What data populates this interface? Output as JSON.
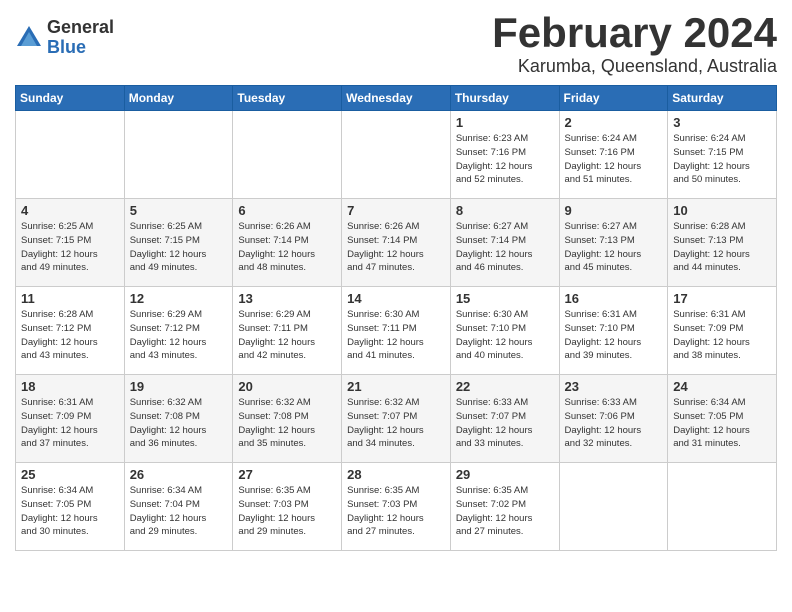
{
  "logo": {
    "general": "General",
    "blue": "Blue"
  },
  "title": "February 2024",
  "location": "Karumba, Queensland, Australia",
  "headers": [
    "Sunday",
    "Monday",
    "Tuesday",
    "Wednesday",
    "Thursday",
    "Friday",
    "Saturday"
  ],
  "weeks": [
    [
      {
        "day": "",
        "info": ""
      },
      {
        "day": "",
        "info": ""
      },
      {
        "day": "",
        "info": ""
      },
      {
        "day": "",
        "info": ""
      },
      {
        "day": "1",
        "info": "Sunrise: 6:23 AM\nSunset: 7:16 PM\nDaylight: 12 hours\nand 52 minutes."
      },
      {
        "day": "2",
        "info": "Sunrise: 6:24 AM\nSunset: 7:16 PM\nDaylight: 12 hours\nand 51 minutes."
      },
      {
        "day": "3",
        "info": "Sunrise: 6:24 AM\nSunset: 7:15 PM\nDaylight: 12 hours\nand 50 minutes."
      }
    ],
    [
      {
        "day": "4",
        "info": "Sunrise: 6:25 AM\nSunset: 7:15 PM\nDaylight: 12 hours\nand 49 minutes."
      },
      {
        "day": "5",
        "info": "Sunrise: 6:25 AM\nSunset: 7:15 PM\nDaylight: 12 hours\nand 49 minutes."
      },
      {
        "day": "6",
        "info": "Sunrise: 6:26 AM\nSunset: 7:14 PM\nDaylight: 12 hours\nand 48 minutes."
      },
      {
        "day": "7",
        "info": "Sunrise: 6:26 AM\nSunset: 7:14 PM\nDaylight: 12 hours\nand 47 minutes."
      },
      {
        "day": "8",
        "info": "Sunrise: 6:27 AM\nSunset: 7:14 PM\nDaylight: 12 hours\nand 46 minutes."
      },
      {
        "day": "9",
        "info": "Sunrise: 6:27 AM\nSunset: 7:13 PM\nDaylight: 12 hours\nand 45 minutes."
      },
      {
        "day": "10",
        "info": "Sunrise: 6:28 AM\nSunset: 7:13 PM\nDaylight: 12 hours\nand 44 minutes."
      }
    ],
    [
      {
        "day": "11",
        "info": "Sunrise: 6:28 AM\nSunset: 7:12 PM\nDaylight: 12 hours\nand 43 minutes."
      },
      {
        "day": "12",
        "info": "Sunrise: 6:29 AM\nSunset: 7:12 PM\nDaylight: 12 hours\nand 43 minutes."
      },
      {
        "day": "13",
        "info": "Sunrise: 6:29 AM\nSunset: 7:11 PM\nDaylight: 12 hours\nand 42 minutes."
      },
      {
        "day": "14",
        "info": "Sunrise: 6:30 AM\nSunset: 7:11 PM\nDaylight: 12 hours\nand 41 minutes."
      },
      {
        "day": "15",
        "info": "Sunrise: 6:30 AM\nSunset: 7:10 PM\nDaylight: 12 hours\nand 40 minutes."
      },
      {
        "day": "16",
        "info": "Sunrise: 6:31 AM\nSunset: 7:10 PM\nDaylight: 12 hours\nand 39 minutes."
      },
      {
        "day": "17",
        "info": "Sunrise: 6:31 AM\nSunset: 7:09 PM\nDaylight: 12 hours\nand 38 minutes."
      }
    ],
    [
      {
        "day": "18",
        "info": "Sunrise: 6:31 AM\nSunset: 7:09 PM\nDaylight: 12 hours\nand 37 minutes."
      },
      {
        "day": "19",
        "info": "Sunrise: 6:32 AM\nSunset: 7:08 PM\nDaylight: 12 hours\nand 36 minutes."
      },
      {
        "day": "20",
        "info": "Sunrise: 6:32 AM\nSunset: 7:08 PM\nDaylight: 12 hours\nand 35 minutes."
      },
      {
        "day": "21",
        "info": "Sunrise: 6:32 AM\nSunset: 7:07 PM\nDaylight: 12 hours\nand 34 minutes."
      },
      {
        "day": "22",
        "info": "Sunrise: 6:33 AM\nSunset: 7:07 PM\nDaylight: 12 hours\nand 33 minutes."
      },
      {
        "day": "23",
        "info": "Sunrise: 6:33 AM\nSunset: 7:06 PM\nDaylight: 12 hours\nand 32 minutes."
      },
      {
        "day": "24",
        "info": "Sunrise: 6:34 AM\nSunset: 7:05 PM\nDaylight: 12 hours\nand 31 minutes."
      }
    ],
    [
      {
        "day": "25",
        "info": "Sunrise: 6:34 AM\nSunset: 7:05 PM\nDaylight: 12 hours\nand 30 minutes."
      },
      {
        "day": "26",
        "info": "Sunrise: 6:34 AM\nSunset: 7:04 PM\nDaylight: 12 hours\nand 29 minutes."
      },
      {
        "day": "27",
        "info": "Sunrise: 6:35 AM\nSunset: 7:03 PM\nDaylight: 12 hours\nand 29 minutes."
      },
      {
        "day": "28",
        "info": "Sunrise: 6:35 AM\nSunset: 7:03 PM\nDaylight: 12 hours\nand 27 minutes."
      },
      {
        "day": "29",
        "info": "Sunrise: 6:35 AM\nSunset: 7:02 PM\nDaylight: 12 hours\nand 27 minutes."
      },
      {
        "day": "",
        "info": ""
      },
      {
        "day": "",
        "info": ""
      }
    ]
  ]
}
